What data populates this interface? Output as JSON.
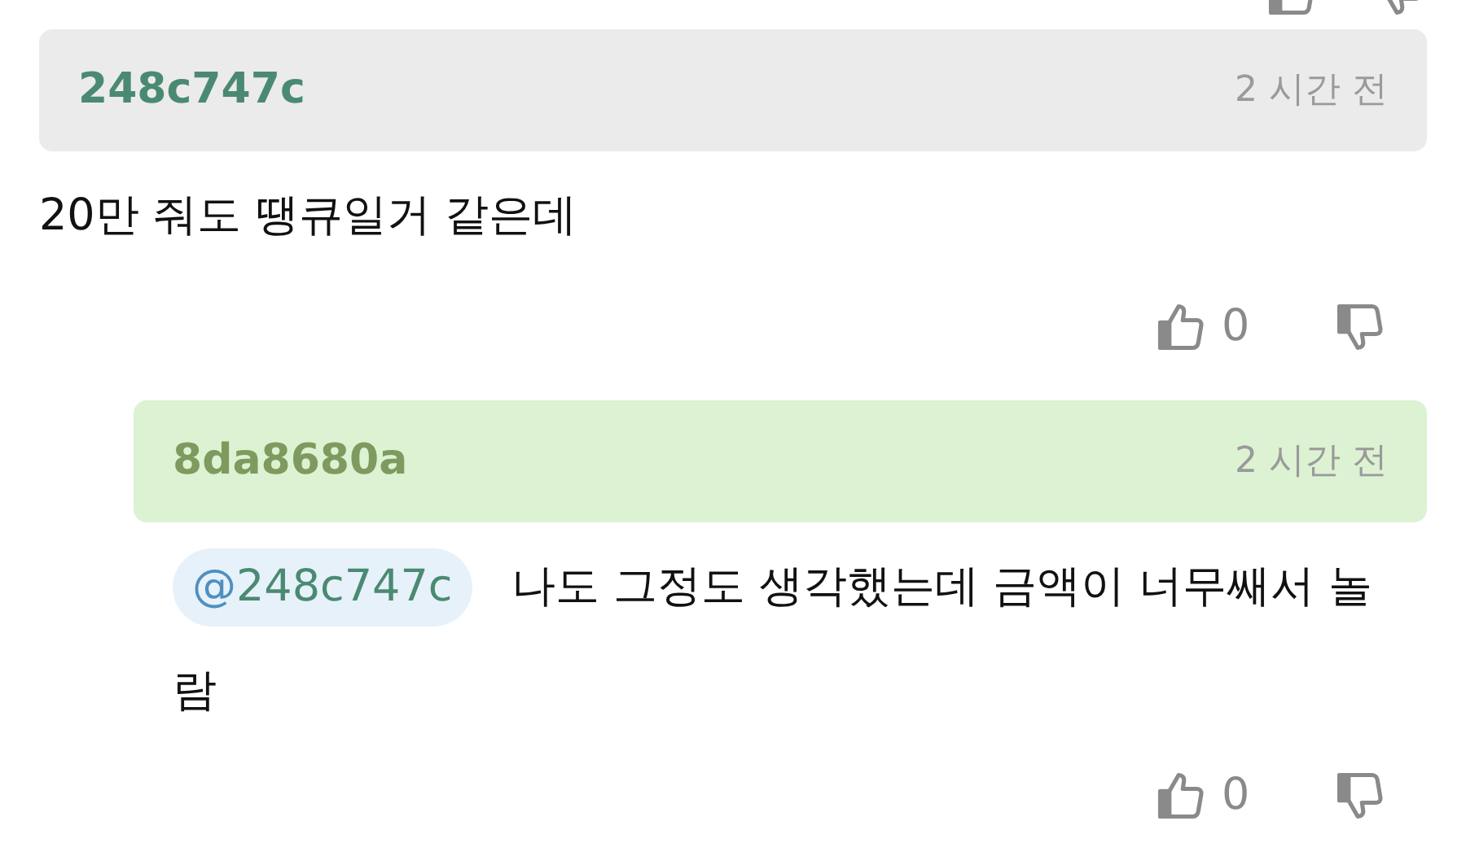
{
  "comments": [
    {
      "kind": "comment",
      "user": "248c747c",
      "time": "2 시간 전",
      "text": "20만 줘도 땡큐일거 같은데",
      "likes": "0"
    },
    {
      "kind": "reply",
      "user": "8da8680a",
      "time": "2 시간 전",
      "mention": {
        "symbol": "@",
        "user": "248c747c"
      },
      "text": "나도 그정도 생각했는데 금액이 너무쌔서 놀람",
      "likes": "0"
    }
  ]
}
